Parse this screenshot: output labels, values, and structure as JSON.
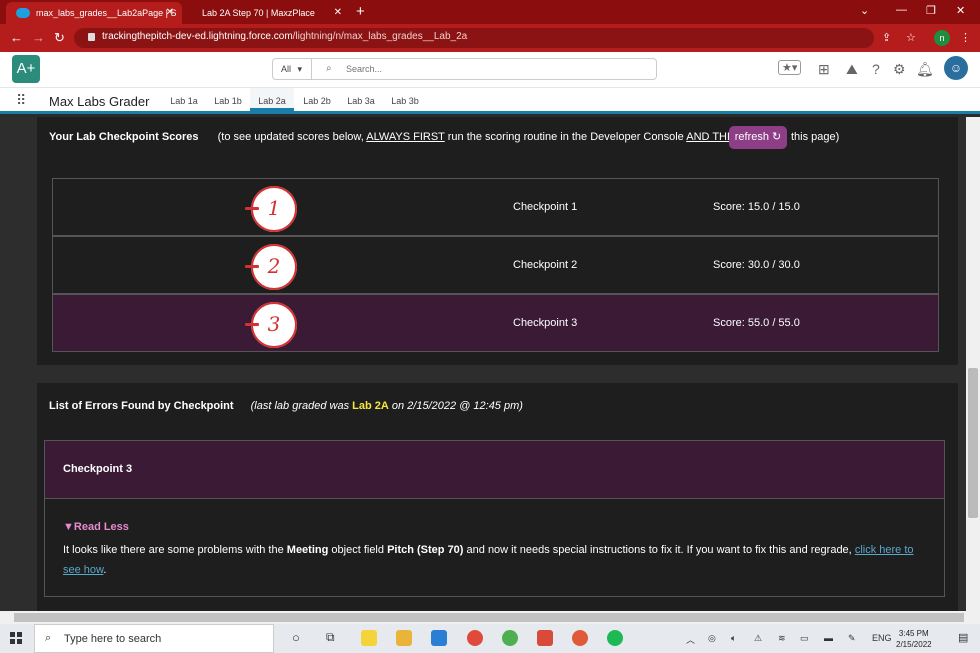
{
  "browser": {
    "tabs": [
      {
        "title": "max_labs_grades__Lab2aPage | S"
      },
      {
        "title": "Lab 2A Step 70 | MaxzPlace"
      }
    ],
    "url_host": "trackingthepitch-dev-ed.lightning.force.com",
    "url_path": "/lightning/n/max_labs_grades__Lab_2a",
    "profile_initial": "n"
  },
  "header": {
    "logo_text": "A+",
    "search_scope": "All",
    "search_placeholder": "Search..."
  },
  "app": {
    "name": "Max Labs Grader",
    "tabs": [
      "Lab 1a",
      "Lab 1b",
      "Lab 2a",
      "Lab 2b",
      "Lab 3a",
      "Lab 3b"
    ],
    "active_tab": "Lab 2a"
  },
  "scores_card": {
    "title": "Your Lab Checkpoint Scores",
    "note_prefix": "(to see updated scores below,",
    "note_always": "ALWAYS FIRST",
    "note_mid": "run the scoring routine in the Developer Console",
    "note_and_then": "AND THEN",
    "refresh_label": "refresh ↻",
    "note_suffix": "this page)"
  },
  "checkpoints": [
    {
      "number": "1",
      "label": "Checkpoint 1",
      "score": "Score: 15.0 / 15.0"
    },
    {
      "number": "2",
      "label": "Checkpoint 2",
      "score": "Score: 30.0 / 30.0"
    },
    {
      "number": "3",
      "label": "Checkpoint 3",
      "score": "Score: 55.0 / 55.0"
    }
  ],
  "errors_card": {
    "title": "List of Errors Found by Checkpoint",
    "last_graded_prefix": "(last lab graded was",
    "last_lab": "Lab 2A",
    "last_graded_suffix": "on 2/15/2022 @ 12:45 pm)",
    "lab_color": "#f5e642",
    "checkpoint_heading": "Checkpoint 3",
    "read_less": "▼Read Less",
    "msg_1": "It looks like there are some problems with the",
    "msg_object": "Meeting",
    "msg_2": "object field",
    "msg_field": "Pitch (Step 70)",
    "msg_3": "and now it needs special instructions to fix it. If you want to fix this and regrade,",
    "link_text": "click here to see how",
    "msg_end": "."
  },
  "taskbar": {
    "search_placeholder": "Type here to search",
    "lang": "ENG",
    "time": "3:45 PM",
    "date": "2/15/2022"
  },
  "colors": {
    "chrome_red": "#b51c1c",
    "accent_purple": "#3a1a35",
    "refresh_purple": "#8e3e86",
    "badge_red": "#d43232",
    "link_blue": "#5aa8cc",
    "read_less_pink": "#e88ad0"
  }
}
